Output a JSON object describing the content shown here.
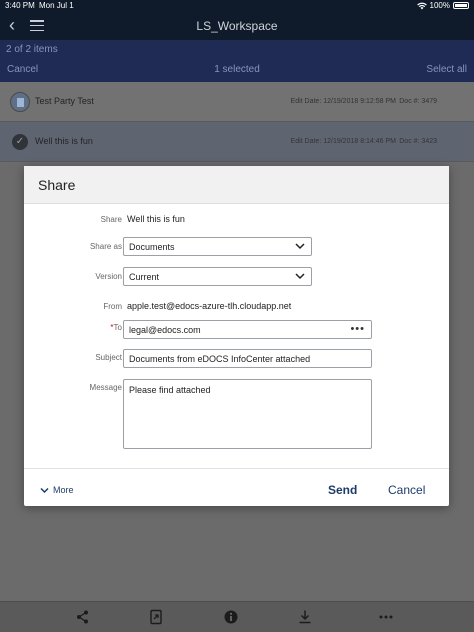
{
  "status": {
    "time": "3:40 PM",
    "date": "Mon Jul 1",
    "battery": "100%"
  },
  "header": {
    "title": "LS_Workspace"
  },
  "selection": {
    "count": "2 of 2 items",
    "cancel": "Cancel",
    "selected": "1 selected",
    "select_all": "Select all"
  },
  "rows": [
    {
      "name": "Test Party Test",
      "edit_date": "Edit Date: 12/19/2018 9:12:58 PM",
      "doc": "Doc #: 3479"
    },
    {
      "name": "Well this is fun",
      "edit_date": "Edit Date: 12/19/2018 8:14:46 PM",
      "doc": "Doc #: 3423"
    }
  ],
  "dialog": {
    "title": "Share",
    "share_label": "Share",
    "share_value": "Well this is fun",
    "share_as_label": "Share as",
    "share_as_value": "Documents",
    "version_label": "Version",
    "version_value": "Current",
    "from_label": "From",
    "from_value": "apple.test@edocs-azure-tlh.cloudapp.net",
    "to_label": "To",
    "to_required": "*",
    "to_value": "legal@edocs.com",
    "subject_label": "Subject",
    "subject_value": "Documents from eDOCS InfoCenter attached",
    "message_label": "Message",
    "message_value": "Please find attached",
    "more": "More",
    "send": "Send",
    "cancel": "Cancel"
  },
  "toolbar": {
    "icons": [
      "share-icon",
      "open-external-icon",
      "info-icon",
      "download-icon",
      "more-icon"
    ]
  }
}
